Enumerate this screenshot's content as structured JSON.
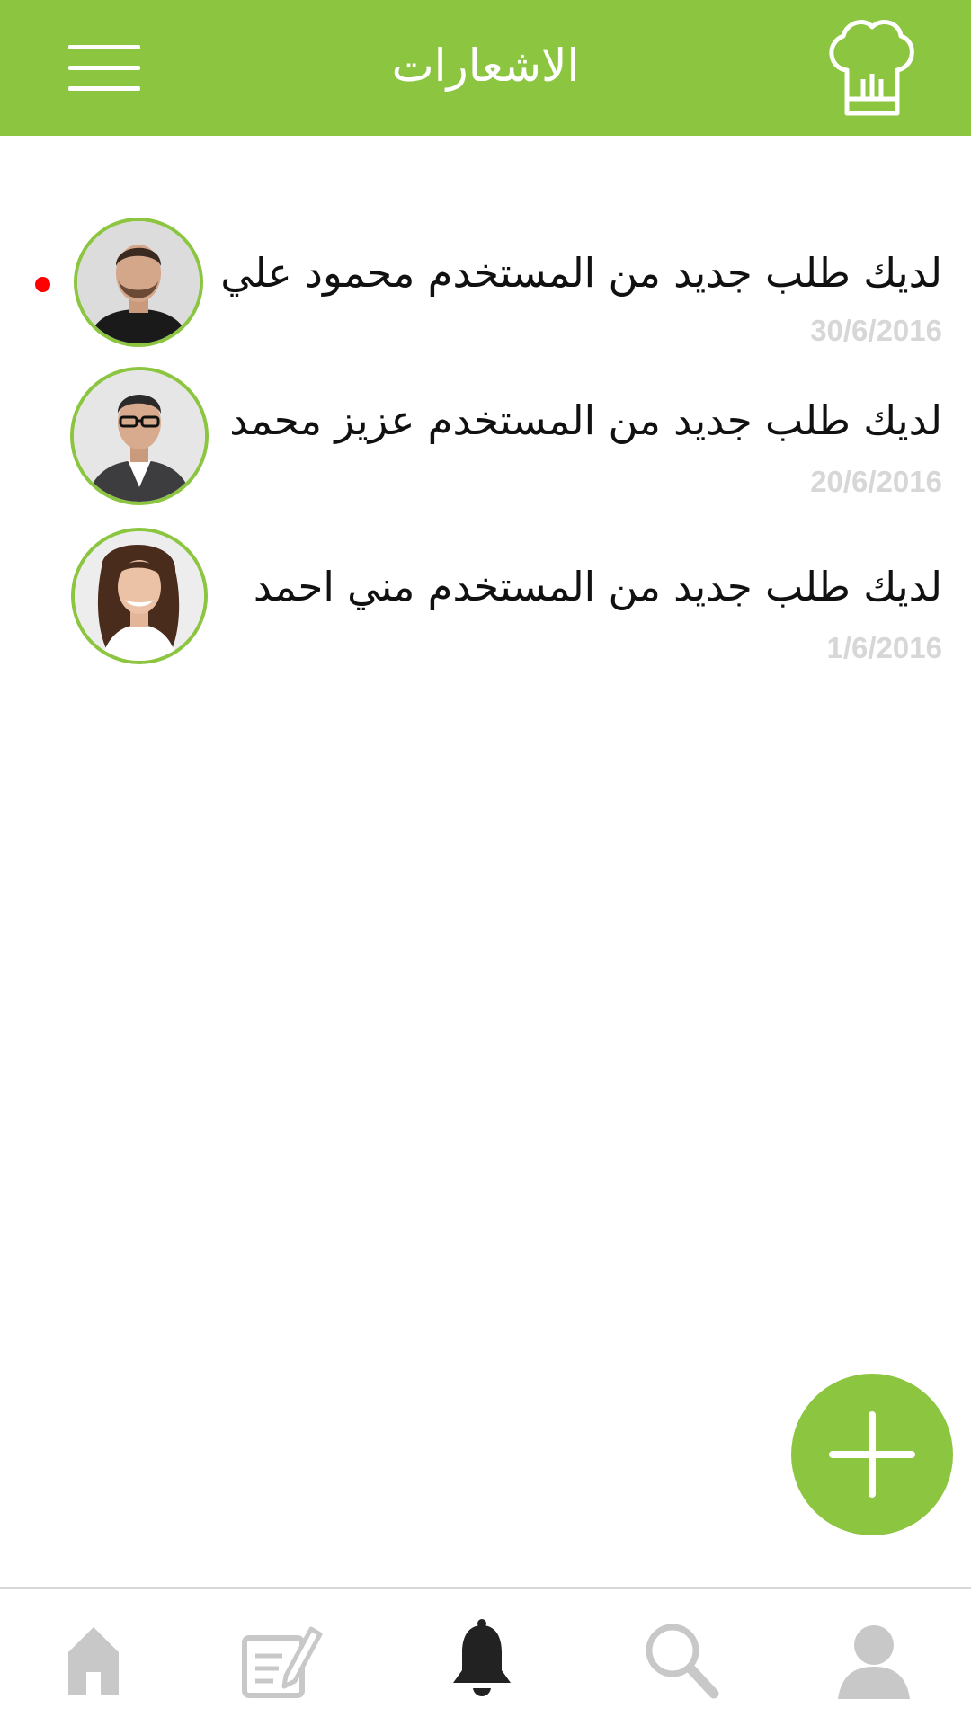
{
  "header": {
    "title": "الاشعارات",
    "menu_icon": "hamburger-menu-icon",
    "logo_icon": "chef-hat-icon",
    "background": "#8cc540"
  },
  "notifications": [
    {
      "text": "لديك طلب جديد من المستخدم محمود علي",
      "date": "30/6/2016",
      "unread": true,
      "avatar": "man-portrait-black-shirt"
    },
    {
      "text": "لديك طلب جديد من المستخدم عزيز محمد",
      "date": "20/6/2016",
      "unread": false,
      "avatar": "man-portrait-glasses-suit"
    },
    {
      "text": "لديك طلب جديد من المستخدم مني احمد",
      "date": "1/6/2016",
      "unread": false,
      "avatar": "woman-portrait-smiling"
    }
  ],
  "fab": {
    "icon": "plus-icon",
    "color": "#8cc540"
  },
  "bottom_nav": {
    "items": [
      {
        "icon": "home-icon",
        "active": false
      },
      {
        "icon": "edit-note-icon",
        "active": false
      },
      {
        "icon": "bell-icon",
        "active": true
      },
      {
        "icon": "search-icon",
        "active": false
      },
      {
        "icon": "user-icon",
        "active": false
      }
    ],
    "active_color": "#222222",
    "inactive_color": "#c8c8c8"
  },
  "colors": {
    "accent": "#8cc540",
    "unread_dot": "#ff0000",
    "date_text": "#d7d7d7"
  }
}
